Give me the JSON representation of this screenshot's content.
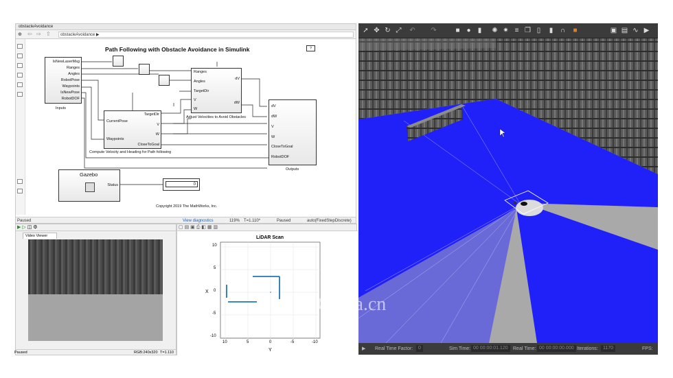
{
  "simulink": {
    "tab": "obstacleAvoidance",
    "breadcrumb": "obstacleAvoidance ▶",
    "title": "Path Following with Obstacle Avoidance in Simulink",
    "inputs_block": {
      "label": "Inputs",
      "ports": [
        "IsNewLaserMsg",
        "Ranges",
        "Angles",
        "RobotPose",
        "Waypoints",
        "IsNewPose",
        "RobotDOF"
      ]
    },
    "pathfollow_block": {
      "label": "Compute Velocity and Heading for Path following",
      "in": [
        "CurrentPose",
        "Waypoints"
      ],
      "out": [
        "TargetDir",
        "V",
        "W",
        "CloseToGoal"
      ]
    },
    "adjust_block": {
      "label": "Adjust Velocities to Avoid Obstacles",
      "in": [
        "Ranges",
        "Angles",
        "TargetDir",
        "V",
        "W"
      ],
      "out": [
        "dV",
        "dW"
      ]
    },
    "outputs_block": {
      "label": "Outputs",
      "ports": [
        "dV",
        "dW",
        "V",
        "W",
        "CloseToGoal",
        "RobotDOF"
      ]
    },
    "gazebo_block": {
      "title": "Gazebo",
      "port": "Status",
      "display_value": "0"
    },
    "copyright": "Copyright 2019 The MathWorks, Inc.",
    "status": {
      "left": "Paused",
      "diag": "View diagnostics",
      "zoom": "119%",
      "time": "T=1.110*",
      "state": "Paused",
      "solver": "auto(FixedStepDiscrete)"
    }
  },
  "video_viewer": {
    "tab": "Video Viewer",
    "status_left": "Paused",
    "status_rgb": "RGB:240x320",
    "status_time": "T=1.110"
  },
  "lidar": {
    "title": "LiDAR Scan",
    "xlabel": "Y",
    "ylabel": "X",
    "yticks": [
      "10",
      "5",
      "0",
      "-5",
      "-10"
    ],
    "xticks": [
      "10",
      "5",
      "0",
      "-5",
      "-10"
    ]
  },
  "gazebo": {
    "status": {
      "rtf_label": "Real Time Factor:",
      "rtf_value": "0",
      "sim_label": "Sim Time:",
      "sim_value": "00 00:00:01.120",
      "real_label": "Real Time:",
      "real_value": "00 00:00:00.000",
      "iter_label": "Iterations:",
      "iter_value": "1170",
      "fps_label": "FPS:"
    }
  },
  "watermark": "China.cn",
  "colors": {
    "scan_blue": "#1515ff",
    "lidar_line": "#1f77b4"
  }
}
